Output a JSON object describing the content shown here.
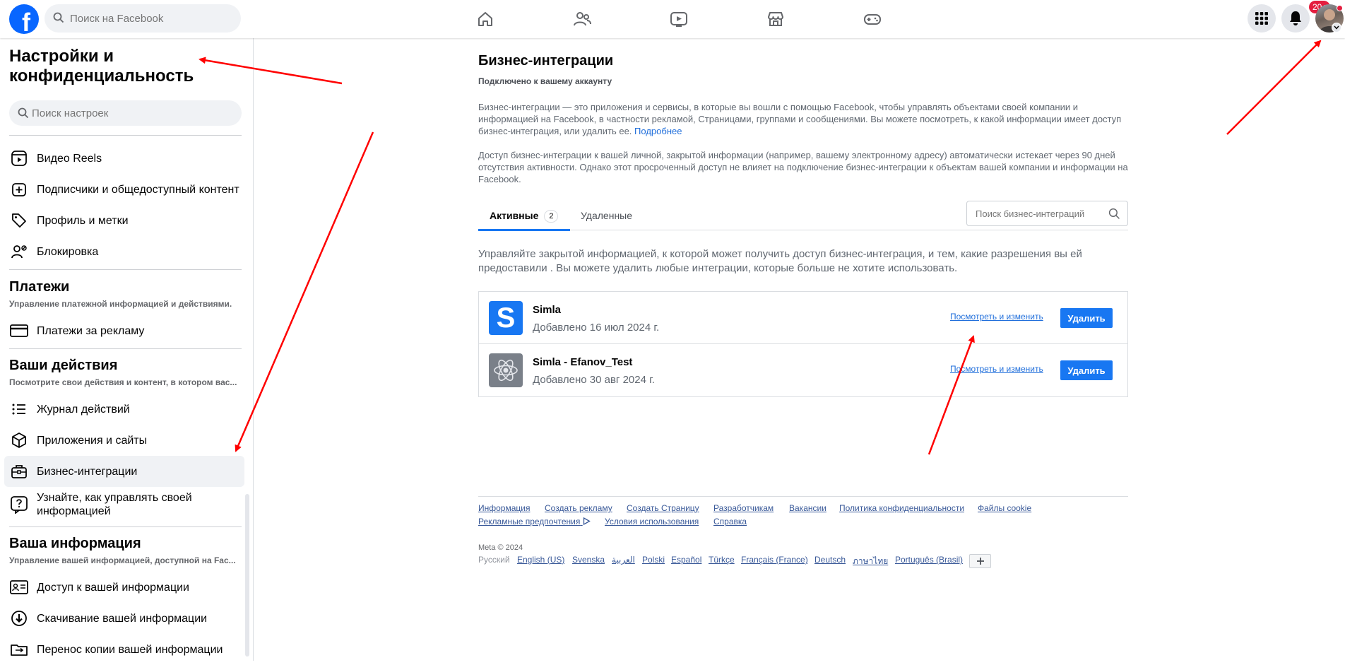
{
  "topbar": {
    "search_placeholder": "Поиск на Facebook",
    "notification_badge": "20+",
    "nav_icons": [
      "home-icon",
      "friends-icon",
      "video-icon",
      "marketplace-icon",
      "gaming-icon"
    ],
    "brand_color": "#0866ff"
  },
  "sidebar": {
    "title": "Настройки и конфиденциальность",
    "search_placeholder": "Поиск настроек",
    "items_top": [
      {
        "label": "Видео Reels",
        "icon": "reels-icon"
      },
      {
        "label": "Подписчики и общедоступный контент",
        "icon": "add-square-icon"
      },
      {
        "label": "Профиль и метки",
        "icon": "tag-icon"
      },
      {
        "label": "Блокировка",
        "icon": "user-block-icon"
      }
    ],
    "payments": {
      "heading": "Платежи",
      "subtitle": "Управление платежной информацией и действиями.",
      "items": [
        {
          "label": "Платежи за рекламу",
          "icon": "card-icon"
        }
      ]
    },
    "activity": {
      "heading": "Ваши действия",
      "subtitle": "Посмотрите свои действия и контент, в котором вас...",
      "items": [
        {
          "label": "Журнал действий",
          "icon": "list-icon"
        },
        {
          "label": "Приложения и сайты",
          "icon": "cube-icon"
        },
        {
          "label": "Бизнес-интеграции",
          "icon": "briefcase-icon"
        },
        {
          "label": "Узнайте, как управлять своей информацией",
          "icon": "help-icon"
        }
      ]
    },
    "your_info": {
      "heading": "Ваша информация",
      "subtitle": "Управление вашей информацией, доступной на Fac...",
      "items": [
        {
          "label": "Доступ к вашей информации",
          "icon": "id-card-icon"
        },
        {
          "label": "Скачивание вашей информации",
          "icon": "download-icon"
        },
        {
          "label": "Перенос копии вашей информации",
          "icon": "transfer-icon"
        }
      ]
    }
  },
  "main": {
    "title": "Бизнес-интеграции",
    "subtitle": "Подключено к вашему аккаунту",
    "paragraph1": "Бизнес-интеграции — это приложения и сервисы, в которые вы вошли с помощью Facebook, чтобы управлять объектами своей компании и информацией на Facebook, в частности рекламой, Страницами, группами и сообщениями. Вы можете посмотреть, к какой информации имеет доступ бизнес-интеграция, или удалить ее.",
    "learn_more": "Подробнее",
    "paragraph2": "Доступ бизнес-интеграции к вашей личной, закрытой информации (например, вашему электронному адресу) автоматически истекает через 90 дней отсутствия активности. Однако этот просроченный доступ не влияет на подключение бизнес-интеграции к объектам вашей компании и информации на Facebook.",
    "tabs": {
      "active": "Активные",
      "active_count": "2",
      "deleted": "Удаленные"
    },
    "integration_search_placeholder": "Поиск бизнес-интеграций",
    "manage_text": "Управляйте закрытой информацией, к которой может получить доступ бизнес-интеграция, и тем, какие разрешения вы ей предоставили . Вы можете удалить любые интеграции, которые больше не хотите использовать.",
    "integrations": [
      {
        "name": "Simla",
        "date": "Добавлено 16 июл 2024 г.",
        "view": "Посмотреть и изменить",
        "remove": "Удалить",
        "logo": "S"
      },
      {
        "name": "Simla - Efanov_Test",
        "date": "Добавлено 30 авг 2024 г.",
        "view": "Посмотреть и изменить",
        "remove": "Удалить",
        "logo": "atom-icon"
      }
    ]
  },
  "footer": {
    "links": [
      "Информация",
      "Создать рекламу",
      "Создать Страницу",
      "Разработчикам",
      "Вакансии",
      "Политика конфиденциальности",
      "Файлы cookie"
    ],
    "links2": [
      "Рекламные предпочтения",
      "Условия использования",
      "Справка"
    ],
    "copyright": "Meta © 2024",
    "languages": {
      "current": "Русский",
      "others": [
        "English (US)",
        "Svenska",
        "العربية",
        "Polski",
        "Español",
        "Türkçe",
        "Français (France)",
        "Deutsch",
        "ภาษาไทย",
        "Português (Brasil)"
      ]
    }
  },
  "colors": {
    "accent": "#1877f2",
    "link": "#216fdb",
    "annotation_arrow": "#ff0000"
  }
}
